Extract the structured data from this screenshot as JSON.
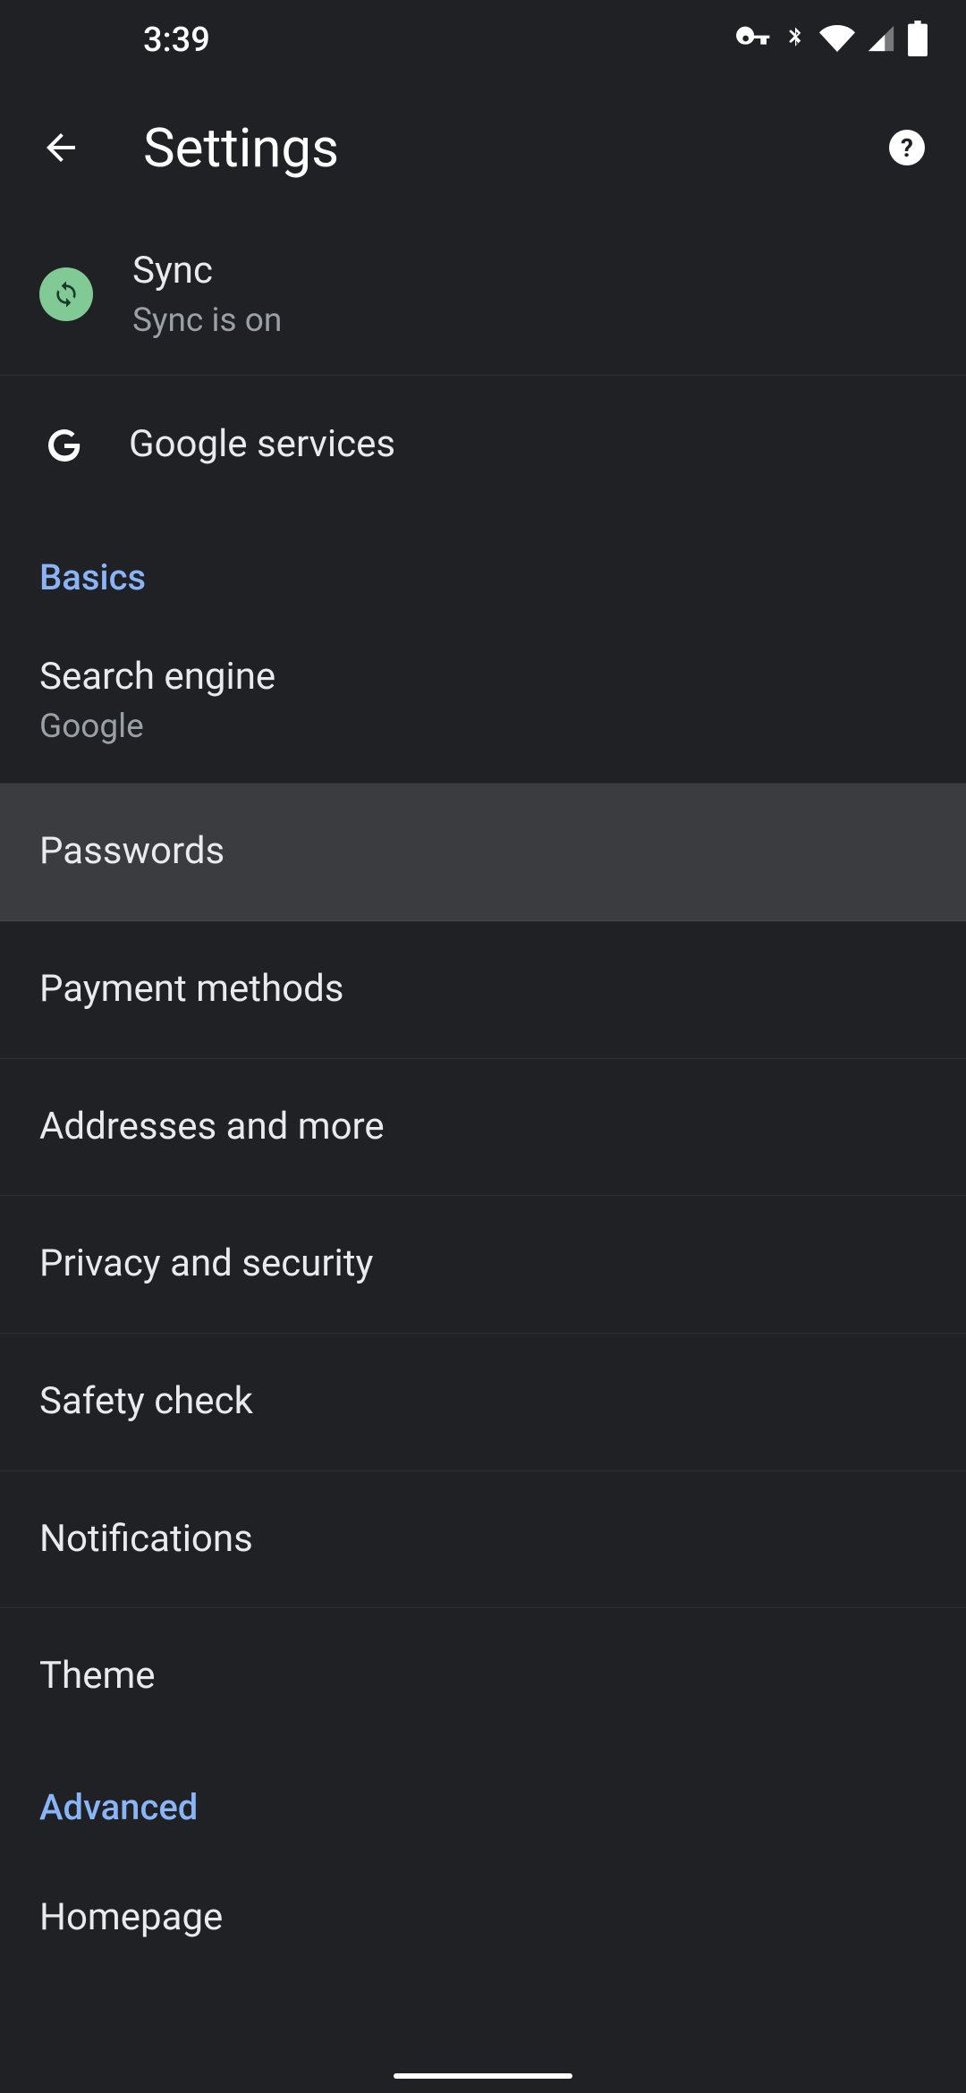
{
  "statusbar": {
    "time": "3:39"
  },
  "header": {
    "title": "Settings"
  },
  "account": {
    "sync_title": "Sync",
    "sync_sub": "Sync is on",
    "google_services": "Google services"
  },
  "sections": {
    "basics": "Basics",
    "advanced": "Advanced"
  },
  "rows": {
    "search_engine": {
      "title": "Search engine",
      "sub": "Google"
    },
    "passwords": {
      "title": "Passwords"
    },
    "payment": {
      "title": "Payment methods"
    },
    "addresses": {
      "title": "Addresses and more"
    },
    "privacy": {
      "title": "Privacy and security"
    },
    "safety": {
      "title": "Safety check"
    },
    "notifications": {
      "title": "Notifications"
    },
    "theme": {
      "title": "Theme"
    },
    "homepage": {
      "title": "Homepage"
    }
  }
}
